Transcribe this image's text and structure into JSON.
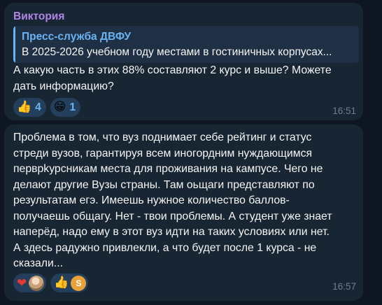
{
  "messages": [
    {
      "sender": "Виктория",
      "reply": {
        "name": "Пресс-служба ДВФУ",
        "text": "В 2025-2026 учебном году местами в гостиничных корпусах..."
      },
      "text": "А какую часть в этих 88% составляют 2 курс и выше? Можете\nдать информацию?",
      "reactions": [
        {
          "emoji": "👍",
          "count": "4"
        },
        {
          "emoji": "😁",
          "count": "1"
        }
      ],
      "time": "16:51"
    },
    {
      "text": "Проблема в том, что вуз поднимает себе рейтинг и статус\nстреди вузов, гарантируя всем иногордним нуждающимся\nперврkурсникам места для проживания на кампусе. Чего не\nделают другие Вузы страны. Там оьщаги представляют по\nрезультатам егэ. Имеешь нужное количество баллов-\nполучаешь общагу. Нет - твои проблемы. А студент уже знает\nнаперёд, надо ему в этот вуз идти на таких условиях или  нет.\nА здесь радужно привлекли, а что будет после 1 курса - не\nсказали...",
      "reactions": [
        {
          "emoji": "❤",
          "avatar": "photo"
        },
        {
          "emoji": "👍",
          "avatar_letter": "S"
        }
      ],
      "time": "16:57"
    }
  ],
  "colors": {
    "background": "#0e1621",
    "bubble": "#182533",
    "sender": "#b185e6",
    "accent": "#6ab3f3",
    "text": "#f5f5f5",
    "time": "#6d7f8f",
    "reaction_bg": "#243f5c"
  }
}
